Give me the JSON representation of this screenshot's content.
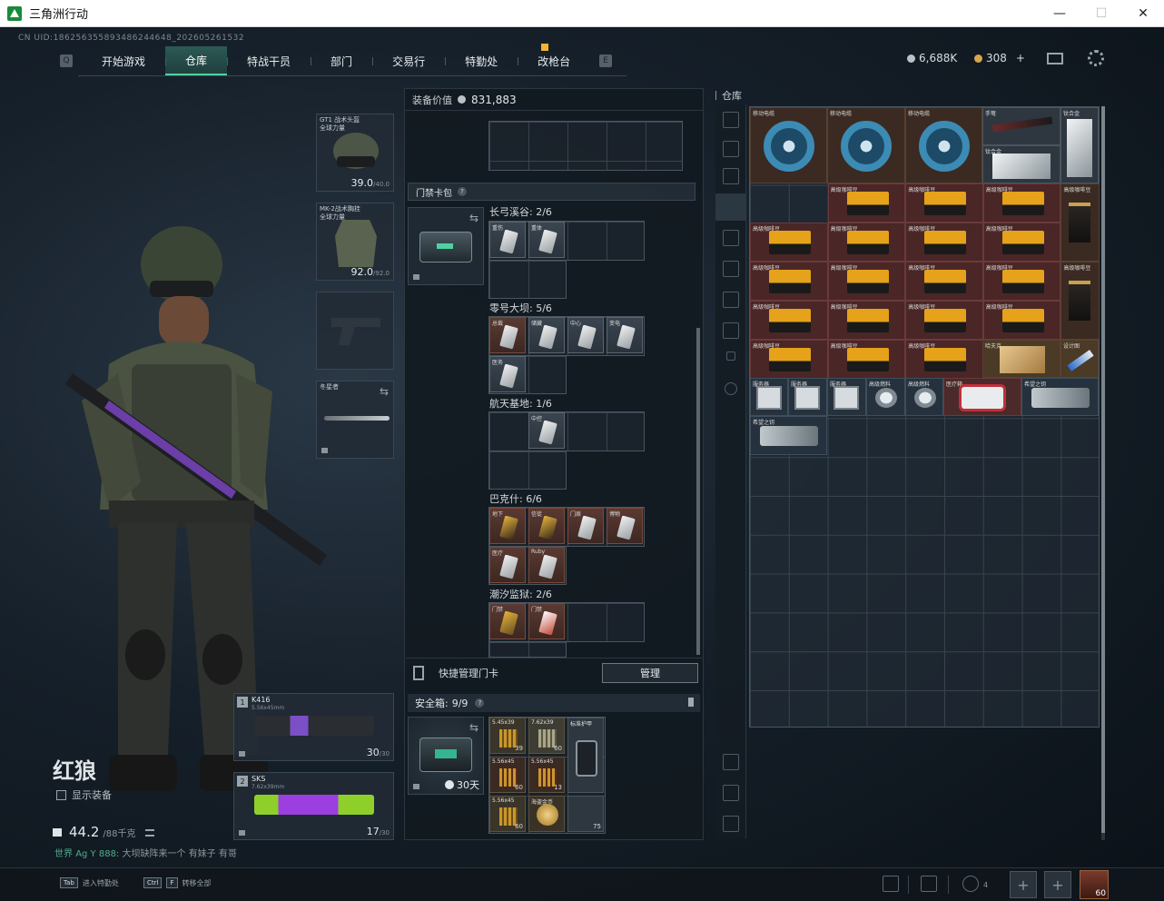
{
  "window": {
    "title": "三角洲行动",
    "min": "—",
    "max": "☐",
    "close": "✕"
  },
  "uid": "CN UID:18625635589348624464​8_202605261532",
  "nav": {
    "tabs": [
      "开始游戏",
      "仓库",
      "特战干员",
      "部门",
      "交易行",
      "特勤处",
      "改枪台"
    ],
    "active": "仓库"
  },
  "currency": {
    "silver": "6,688K",
    "gold": "308",
    "plus": "+"
  },
  "character": {
    "name": "红狼",
    "show_gear": "显示装备",
    "weight": "44.2",
    "weight_max": "/88千克"
  },
  "chat": {
    "channel": "世界",
    "user": "Ag Y 888:",
    "message": "大坝缺阵来一个  有妹子 有哥"
  },
  "equipment": {
    "helmet": {
      "label": "GT1 战术头盔",
      "sub": "全球力量",
      "value": "39.0",
      "max": "/40.0"
    },
    "armor": {
      "label": "MK-2战术胸挂",
      "sub": "全球力量",
      "value": "92.0",
      "max": "/92.0"
    },
    "melee": {
      "label": "冬星者"
    }
  },
  "weapons": [
    {
      "slot": "1",
      "name": "K416",
      "caliber": "5.56x45mm",
      "mag": "30",
      "mag_max": "/30"
    },
    {
      "slot": "2",
      "name": "SKS",
      "caliber": "7.62x39mm",
      "mag": "17",
      "mag_max": "/30"
    }
  ],
  "gear_value": {
    "label": "装备价值",
    "value": "831,883"
  },
  "keycard_pack": {
    "label": "门禁卡包",
    "help": "?"
  },
  "zones": [
    {
      "name": "长弓溪谷: 2/6"
    },
    {
      "name": "零号大坝: 5/6"
    },
    {
      "name": "航天基地: 1/6"
    },
    {
      "name": "巴克什: 6/6"
    },
    {
      "name": "潮汐监狱: 2/6"
    }
  ],
  "card_tags": {
    "z1": [
      "重伤",
      "重体"
    ],
    "z2": [
      "总裁",
      "储藏",
      "中心",
      "变电",
      "医务"
    ],
    "z3": [
      "中控"
    ],
    "z4": [
      "地下",
      "信徒",
      "门扉",
      "博物",
      "医疗",
      "Ruby"
    ],
    "z5": [
      "门禁",
      "门禁"
    ]
  },
  "quick_manage": {
    "label": "快捷管理门卡",
    "button": "管理"
  },
  "safe_box": {
    "label": "安全箱:",
    "count": "9/9",
    "help": "?",
    "timer": "30天"
  },
  "safe_items": [
    {
      "tag": "5.45x39",
      "count": "39"
    },
    {
      "tag": "7.62x39",
      "count": "60"
    },
    {
      "tag": "标准护甲",
      "count": ""
    },
    {
      "tag": "5.56x45",
      "count": "60"
    },
    {
      "tag": "5.56x45",
      "count": "13"
    },
    {
      "tag": "5.56x45",
      "count": "60"
    },
    {
      "tag": "海盗金币",
      "count": ""
    },
    {
      "tag": "",
      "count": "75"
    }
  ],
  "warehouse": {
    "title": "仓库",
    "items": {
      "reel": "移动电缆",
      "crossbow": "手弩",
      "cigbox": "钛合金",
      "cigbox2": "钛合金",
      "coffee": "高级咖啡豆",
      "mapfile": "哈夫克",
      "blueprint": "设计图",
      "server": "服务器",
      "fuel": "高级燃料",
      "medkit": "医疗箱",
      "hope_key": "希望之钥"
    }
  },
  "bottom": {
    "hint1_key": "Tab",
    "hint1": "进入特勤处",
    "hint2_key": "Ctrl",
    "hint2_key2": "F",
    "hint2": "转移全部",
    "friends": "4",
    "avatar_level": "60"
  }
}
